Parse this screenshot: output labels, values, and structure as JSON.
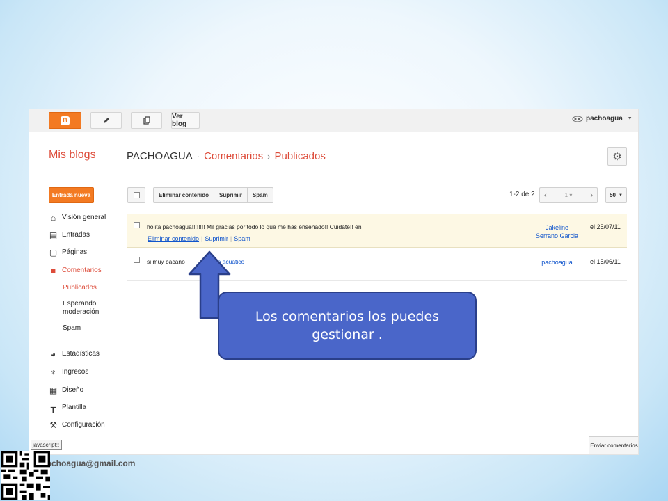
{
  "topbar": {
    "view_blog": "Ver blog",
    "username": "pachoagua",
    "blogger_logo": "B"
  },
  "header": {
    "my_blogs": "Mis blogs",
    "blog_name": "PACHOAGUA",
    "crumb_comments": "Comentarios",
    "crumb_published": "Publicados"
  },
  "sidebar": {
    "new_post": "Entrada nueva",
    "items": [
      {
        "label": "Visión general",
        "icon": "home-icon"
      },
      {
        "label": "Entradas",
        "icon": "posts-icon"
      },
      {
        "label": "Páginas",
        "icon": "pages-icon"
      },
      {
        "label": "Comentarios",
        "icon": "comment-icon"
      },
      {
        "label": "Estadísticas",
        "icon": "pie-chart-icon"
      },
      {
        "label": "Ingresos",
        "icon": "trophy-icon"
      },
      {
        "label": "Diseño",
        "icon": "layout-icon"
      },
      {
        "label": "Plantilla",
        "icon": "paint-roller-icon"
      },
      {
        "label": "Configuración",
        "icon": "wrench-icon"
      }
    ],
    "sub": {
      "published": "Publicados",
      "awaiting_1": "Esperando",
      "awaiting_2": "moderación",
      "spam": "Spam"
    }
  },
  "toolbar": {
    "remove_content": "Eliminar contenido",
    "delete": "Suprimir",
    "spam": "Spam",
    "range": "1-2 de 2",
    "page": "1",
    "per_page": "50"
  },
  "comments": [
    {
      "text": "holita pachoagua!!!!!!!! Mil gracias por todo lo que me has enseñado!! Cuidate!! en",
      "author_1": "Jakeline",
      "author_2": "Serrano Garcia",
      "date": "el 25/07/11",
      "actions": {
        "remove": "Eliminar contenido",
        "delete": "Suprimir",
        "spam": "Spam"
      }
    },
    {
      "text_start": "si muy bacano",
      "text_link": "do acuatico",
      "author_1": "pachoagua",
      "date": "el 15/06/11"
    }
  ],
  "footer": {
    "send_feedback": "Enviar comentarios",
    "status_tip": "javascript:;",
    "email": "pachoagua@gmail.com"
  },
  "callout": {
    "text": "Los comentarios  los puedes gestionar ."
  },
  "colors": {
    "accent_orange": "#f37a22",
    "breadcrumb_red": "#dd4b39",
    "link_blue": "#1155cc",
    "callout_blue": "#4a66c9"
  }
}
